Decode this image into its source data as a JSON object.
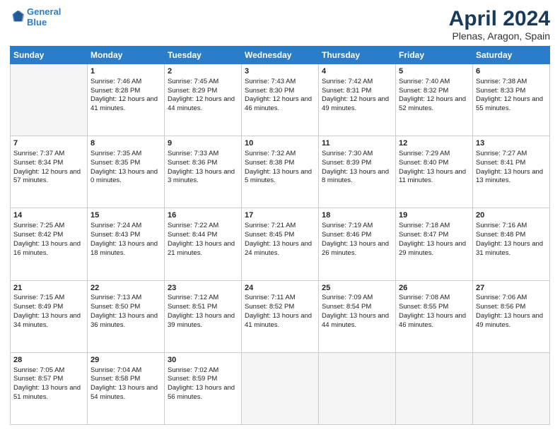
{
  "header": {
    "logo_line1": "General",
    "logo_line2": "Blue",
    "title": "April 2024",
    "subtitle": "Plenas, Aragon, Spain"
  },
  "days_header": [
    "Sunday",
    "Monday",
    "Tuesday",
    "Wednesday",
    "Thursday",
    "Friday",
    "Saturday"
  ],
  "weeks": [
    [
      {
        "day": "",
        "sunrise": "",
        "sunset": "",
        "daylight": ""
      },
      {
        "day": "1",
        "sunrise": "Sunrise: 7:46 AM",
        "sunset": "Sunset: 8:28 PM",
        "daylight": "Daylight: 12 hours and 41 minutes."
      },
      {
        "day": "2",
        "sunrise": "Sunrise: 7:45 AM",
        "sunset": "Sunset: 8:29 PM",
        "daylight": "Daylight: 12 hours and 44 minutes."
      },
      {
        "day": "3",
        "sunrise": "Sunrise: 7:43 AM",
        "sunset": "Sunset: 8:30 PM",
        "daylight": "Daylight: 12 hours and 46 minutes."
      },
      {
        "day": "4",
        "sunrise": "Sunrise: 7:42 AM",
        "sunset": "Sunset: 8:31 PM",
        "daylight": "Daylight: 12 hours and 49 minutes."
      },
      {
        "day": "5",
        "sunrise": "Sunrise: 7:40 AM",
        "sunset": "Sunset: 8:32 PM",
        "daylight": "Daylight: 12 hours and 52 minutes."
      },
      {
        "day": "6",
        "sunrise": "Sunrise: 7:38 AM",
        "sunset": "Sunset: 8:33 PM",
        "daylight": "Daylight: 12 hours and 55 minutes."
      }
    ],
    [
      {
        "day": "7",
        "sunrise": "Sunrise: 7:37 AM",
        "sunset": "Sunset: 8:34 PM",
        "daylight": "Daylight: 12 hours and 57 minutes."
      },
      {
        "day": "8",
        "sunrise": "Sunrise: 7:35 AM",
        "sunset": "Sunset: 8:35 PM",
        "daylight": "Daylight: 13 hours and 0 minutes."
      },
      {
        "day": "9",
        "sunrise": "Sunrise: 7:33 AM",
        "sunset": "Sunset: 8:36 PM",
        "daylight": "Daylight: 13 hours and 3 minutes."
      },
      {
        "day": "10",
        "sunrise": "Sunrise: 7:32 AM",
        "sunset": "Sunset: 8:38 PM",
        "daylight": "Daylight: 13 hours and 5 minutes."
      },
      {
        "day": "11",
        "sunrise": "Sunrise: 7:30 AM",
        "sunset": "Sunset: 8:39 PM",
        "daylight": "Daylight: 13 hours and 8 minutes."
      },
      {
        "day": "12",
        "sunrise": "Sunrise: 7:29 AM",
        "sunset": "Sunset: 8:40 PM",
        "daylight": "Daylight: 13 hours and 11 minutes."
      },
      {
        "day": "13",
        "sunrise": "Sunrise: 7:27 AM",
        "sunset": "Sunset: 8:41 PM",
        "daylight": "Daylight: 13 hours and 13 minutes."
      }
    ],
    [
      {
        "day": "14",
        "sunrise": "Sunrise: 7:25 AM",
        "sunset": "Sunset: 8:42 PM",
        "daylight": "Daylight: 13 hours and 16 minutes."
      },
      {
        "day": "15",
        "sunrise": "Sunrise: 7:24 AM",
        "sunset": "Sunset: 8:43 PM",
        "daylight": "Daylight: 13 hours and 18 minutes."
      },
      {
        "day": "16",
        "sunrise": "Sunrise: 7:22 AM",
        "sunset": "Sunset: 8:44 PM",
        "daylight": "Daylight: 13 hours and 21 minutes."
      },
      {
        "day": "17",
        "sunrise": "Sunrise: 7:21 AM",
        "sunset": "Sunset: 8:45 PM",
        "daylight": "Daylight: 13 hours and 24 minutes."
      },
      {
        "day": "18",
        "sunrise": "Sunrise: 7:19 AM",
        "sunset": "Sunset: 8:46 PM",
        "daylight": "Daylight: 13 hours and 26 minutes."
      },
      {
        "day": "19",
        "sunrise": "Sunrise: 7:18 AM",
        "sunset": "Sunset: 8:47 PM",
        "daylight": "Daylight: 13 hours and 29 minutes."
      },
      {
        "day": "20",
        "sunrise": "Sunrise: 7:16 AM",
        "sunset": "Sunset: 8:48 PM",
        "daylight": "Daylight: 13 hours and 31 minutes."
      }
    ],
    [
      {
        "day": "21",
        "sunrise": "Sunrise: 7:15 AM",
        "sunset": "Sunset: 8:49 PM",
        "daylight": "Daylight: 13 hours and 34 minutes."
      },
      {
        "day": "22",
        "sunrise": "Sunrise: 7:13 AM",
        "sunset": "Sunset: 8:50 PM",
        "daylight": "Daylight: 13 hours and 36 minutes."
      },
      {
        "day": "23",
        "sunrise": "Sunrise: 7:12 AM",
        "sunset": "Sunset: 8:51 PM",
        "daylight": "Daylight: 13 hours and 39 minutes."
      },
      {
        "day": "24",
        "sunrise": "Sunrise: 7:11 AM",
        "sunset": "Sunset: 8:52 PM",
        "daylight": "Daylight: 13 hours and 41 minutes."
      },
      {
        "day": "25",
        "sunrise": "Sunrise: 7:09 AM",
        "sunset": "Sunset: 8:54 PM",
        "daylight": "Daylight: 13 hours and 44 minutes."
      },
      {
        "day": "26",
        "sunrise": "Sunrise: 7:08 AM",
        "sunset": "Sunset: 8:55 PM",
        "daylight": "Daylight: 13 hours and 46 minutes."
      },
      {
        "day": "27",
        "sunrise": "Sunrise: 7:06 AM",
        "sunset": "Sunset: 8:56 PM",
        "daylight": "Daylight: 13 hours and 49 minutes."
      }
    ],
    [
      {
        "day": "28",
        "sunrise": "Sunrise: 7:05 AM",
        "sunset": "Sunset: 8:57 PM",
        "daylight": "Daylight: 13 hours and 51 minutes."
      },
      {
        "day": "29",
        "sunrise": "Sunrise: 7:04 AM",
        "sunset": "Sunset: 8:58 PM",
        "daylight": "Daylight: 13 hours and 54 minutes."
      },
      {
        "day": "30",
        "sunrise": "Sunrise: 7:02 AM",
        "sunset": "Sunset: 8:59 PM",
        "daylight": "Daylight: 13 hours and 56 minutes."
      },
      {
        "day": "",
        "sunrise": "",
        "sunset": "",
        "daylight": ""
      },
      {
        "day": "",
        "sunrise": "",
        "sunset": "",
        "daylight": ""
      },
      {
        "day": "",
        "sunrise": "",
        "sunset": "",
        "daylight": ""
      },
      {
        "day": "",
        "sunrise": "",
        "sunset": "",
        "daylight": ""
      }
    ]
  ]
}
